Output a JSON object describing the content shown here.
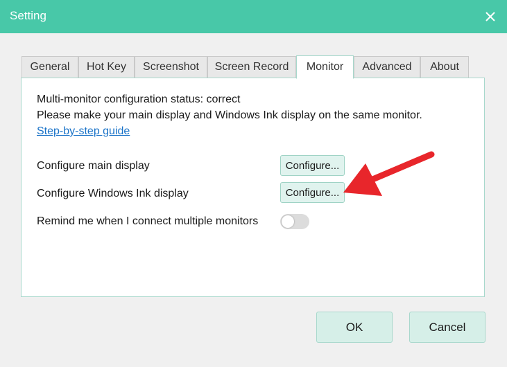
{
  "window": {
    "title": "Setting",
    "close_icon": "close-icon"
  },
  "tabs": [
    {
      "label": "General"
    },
    {
      "label": "Hot Key"
    },
    {
      "label": "Screenshot"
    },
    {
      "label": "Screen Record"
    },
    {
      "label": "Monitor",
      "active": true
    },
    {
      "label": "Advanced"
    },
    {
      "label": "About"
    }
  ],
  "monitor": {
    "status_text": "Multi-monitor configuration status: correct",
    "instruction_text": "Please make your main display and Windows Ink display on the same monitor.",
    "guide_link": "Step-by-step guide",
    "main_display_label": "Configure main display",
    "main_display_button": "Configure...",
    "ink_display_label": "Configure Windows Ink display",
    "ink_display_button": "Configure...",
    "remind_label": "Remind me when I connect multiple monitors",
    "remind_enabled": false
  },
  "footer": {
    "ok_label": "OK",
    "cancel_label": "Cancel"
  },
  "colors": {
    "titlebar": "#48c8a8",
    "accent_button": "#d6efe8",
    "link": "#1a73c8",
    "annotation_arrow": "#e8262b"
  }
}
